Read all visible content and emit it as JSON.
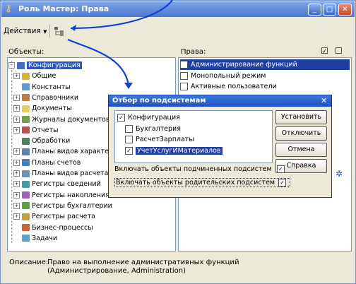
{
  "window": {
    "title": "Роль Мастер: Права",
    "minimize_glyph": "_",
    "maximize_glyph": "□",
    "close_glyph": "✕"
  },
  "toolbar": {
    "actions_label": "Действия"
  },
  "objects": {
    "label": "Объекты:",
    "items": [
      {
        "label": "Конфигурация",
        "icon": "config-icon",
        "color": "#3c6fd0"
      },
      {
        "label": "Общие",
        "icon": "folder-icon",
        "color": "#d8b040"
      },
      {
        "label": "Константы",
        "icon": "constants-icon",
        "color": "#5a9ad8"
      },
      {
        "label": "Справочники",
        "icon": "catalog-icon",
        "color": "#c08040"
      },
      {
        "label": "Документы",
        "icon": "document-icon",
        "color": "#e8d060"
      },
      {
        "label": "Журналы документов",
        "icon": "journal-icon",
        "color": "#70a050"
      },
      {
        "label": "Отчеты",
        "icon": "report-icon",
        "color": "#c05050"
      },
      {
        "label": "Обработки",
        "icon": "processing-icon",
        "color": "#508060"
      },
      {
        "label": "Планы видов характер",
        "icon": "plan-icon",
        "color": "#6080b0"
      },
      {
        "label": "Планы счетов",
        "icon": "accounts-icon",
        "color": "#4080c0"
      },
      {
        "label": "Планы видов расчета",
        "icon": "calc-plan-icon",
        "color": "#7090b0"
      },
      {
        "label": "Регистры сведений",
        "icon": "register-icon",
        "color": "#40a0a0"
      },
      {
        "label": "Регистры накопления",
        "icon": "accumulation-icon",
        "color": "#a060c0"
      },
      {
        "label": "Регистры бухгалтерии",
        "icon": "accounting-icon",
        "color": "#60a040"
      },
      {
        "label": "Регистры расчета",
        "icon": "calc-register-icon",
        "color": "#c0a040"
      },
      {
        "label": "Бизнес-процессы",
        "icon": "bp-icon",
        "color": "#d06030"
      },
      {
        "label": "Задачи",
        "icon": "task-icon",
        "color": "#60a0c0"
      }
    ]
  },
  "rights": {
    "label": "Права:",
    "items": [
      {
        "label": "Администрирование функций",
        "checked": false,
        "selected": true
      },
      {
        "label": "Монопольный режим",
        "checked": false,
        "selected": false
      },
      {
        "label": "Активные пользователи",
        "checked": false,
        "selected": false
      }
    ]
  },
  "dialog": {
    "title": "Отбор по подсистемам",
    "close_glyph": "✕",
    "tree": [
      {
        "label": "Конфигурация",
        "checked": true,
        "selected": false
      },
      {
        "label": "Бухгалтерия",
        "checked": false,
        "selected": false
      },
      {
        "label": "РасчетЗарплаты",
        "checked": false,
        "selected": false
      },
      {
        "label": "УчетУслугИМатериалов",
        "checked": true,
        "selected": true
      }
    ],
    "buttons": {
      "set": "Установить",
      "disable": "Отключить",
      "cancel": "Отмена",
      "help": "Справка"
    },
    "include_child": "Включать объекты подчиненных подсистем",
    "include_parent": "Включать объекты родительских подсистем",
    "include_child_checked": true,
    "include_parent_checked": true
  },
  "description": {
    "label": "Описание:",
    "line1": "Право на выполнение административных функций",
    "line2": "(Администрирование, Administration)"
  }
}
